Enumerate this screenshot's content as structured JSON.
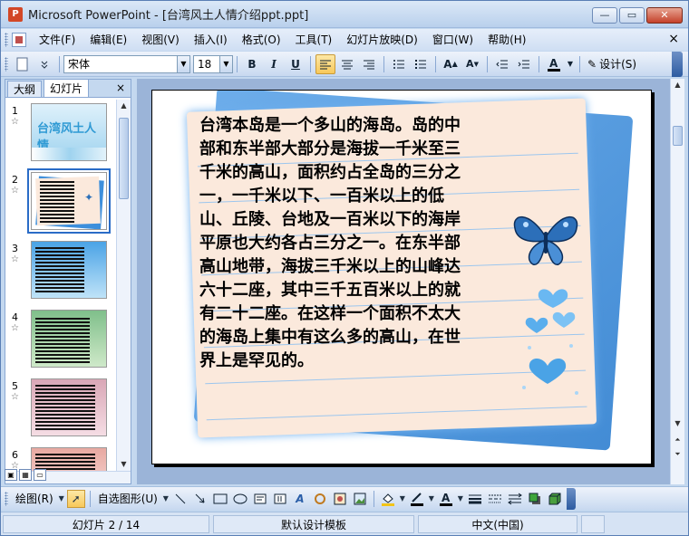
{
  "window": {
    "title": "Microsoft PowerPoint - [台湾风土人情介绍ppt.ppt]",
    "app_icon_letter": "P",
    "btn_min": "—",
    "btn_max": "▭",
    "btn_close": "✕"
  },
  "menu": {
    "items": [
      "文件(F)",
      "编辑(E)",
      "视图(V)",
      "插入(I)",
      "格式(O)",
      "工具(T)",
      "幻灯片放映(D)",
      "窗口(W)",
      "帮助(H)"
    ],
    "close_glyph": "×"
  },
  "toolbar": {
    "font_name": "宋体",
    "font_size": "18",
    "bold": "B",
    "italic": "I",
    "underline": "U",
    "design_label": "设计(S)"
  },
  "left_panel": {
    "tab_outline": "大纲",
    "tab_slides": "幻灯片",
    "tab_close": "×",
    "thumbnails": [
      {
        "num": "1",
        "title": "台湾风土人情"
      },
      {
        "num": "2",
        "title": ""
      },
      {
        "num": "3",
        "title": ""
      },
      {
        "num": "4",
        "title": ""
      },
      {
        "num": "5",
        "title": ""
      },
      {
        "num": "6",
        "title": ""
      }
    ],
    "star_glyph": "☆"
  },
  "slide": {
    "body_text": "台湾本岛是一个多山的海岛。岛的中部和东半部大部分是海拔一千米至三千米的高山，面积约占全岛的三分之一，一千米以下、一百米以上的低山、丘陵、台地及一百米以下的海岸平原也大约各占三分之一。在东半部高山地带，海拔三千米以上的山峰达六十二座，其中三千五百米以上的就有二十二座。在这样一个面积不太大的海岛上集中有这么多的高山，在世界上是罕见的。"
  },
  "drawing_toolbar": {
    "draw_label": "绘图(R)",
    "autoshapes_label": "自选图形(U)"
  },
  "status": {
    "slide_position": "幻灯片 2 / 14",
    "template": "默认设计模板",
    "language": "中文(中国)"
  },
  "colors": {
    "accent_blue": "#2e7fd0",
    "paper": "#fbe9dc",
    "selection": "#2a6cc7"
  }
}
